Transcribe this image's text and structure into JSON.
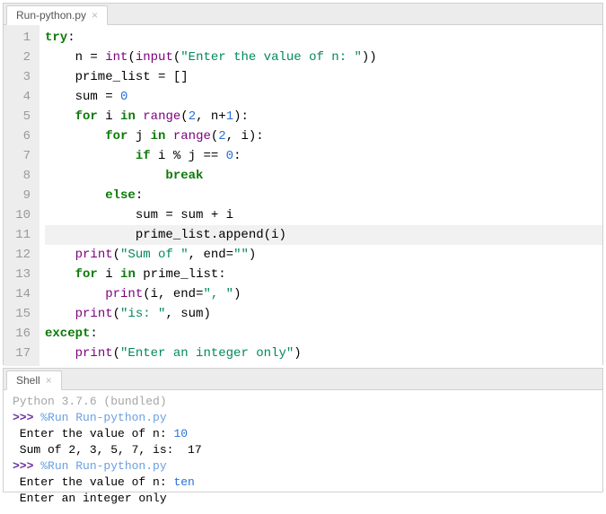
{
  "editor": {
    "tab_name": "Run-python.py",
    "gutter": [
      "1",
      "2",
      "3",
      "4",
      "5",
      "6",
      "7",
      "8",
      "9",
      "10",
      "11",
      "12",
      "13",
      "14",
      "15",
      "16",
      "17"
    ],
    "highlight_line_index": 10,
    "lines": [
      {
        "segs": [
          {
            "c": "kw",
            "t": "try"
          },
          {
            "t": ":"
          }
        ]
      },
      {
        "segs": [
          {
            "t": "    n = "
          },
          {
            "c": "bn",
            "t": "int"
          },
          {
            "t": "("
          },
          {
            "c": "bn",
            "t": "input"
          },
          {
            "t": "("
          },
          {
            "c": "str",
            "t": "\"Enter the value of n: \""
          },
          {
            "t": "))"
          }
        ]
      },
      {
        "segs": [
          {
            "t": "    prime_list = []"
          }
        ]
      },
      {
        "segs": [
          {
            "t": "    sum = "
          },
          {
            "c": "num",
            "t": "0"
          }
        ]
      },
      {
        "segs": [
          {
            "t": "    "
          },
          {
            "c": "kw",
            "t": "for"
          },
          {
            "t": " i "
          },
          {
            "c": "kw",
            "t": "in"
          },
          {
            "t": " "
          },
          {
            "c": "bn",
            "t": "range"
          },
          {
            "t": "("
          },
          {
            "c": "num",
            "t": "2"
          },
          {
            "t": ", n+"
          },
          {
            "c": "num",
            "t": "1"
          },
          {
            "t": "):"
          }
        ]
      },
      {
        "segs": [
          {
            "t": "        "
          },
          {
            "c": "kw",
            "t": "for"
          },
          {
            "t": " j "
          },
          {
            "c": "kw",
            "t": "in"
          },
          {
            "t": " "
          },
          {
            "c": "bn",
            "t": "range"
          },
          {
            "t": "("
          },
          {
            "c": "num",
            "t": "2"
          },
          {
            "t": ", i):"
          }
        ]
      },
      {
        "segs": [
          {
            "t": "            "
          },
          {
            "c": "kw",
            "t": "if"
          },
          {
            "t": " i % j == "
          },
          {
            "c": "num",
            "t": "0"
          },
          {
            "t": ":"
          }
        ]
      },
      {
        "segs": [
          {
            "t": "                "
          },
          {
            "c": "kw",
            "t": "break"
          }
        ]
      },
      {
        "segs": [
          {
            "t": "        "
          },
          {
            "c": "kw",
            "t": "else"
          },
          {
            "t": ":"
          }
        ]
      },
      {
        "segs": [
          {
            "t": "            sum = sum + i"
          }
        ]
      },
      {
        "segs": [
          {
            "t": "            prime_list.append(i)"
          }
        ]
      },
      {
        "segs": [
          {
            "t": "    "
          },
          {
            "c": "bn",
            "t": "print"
          },
          {
            "t": "("
          },
          {
            "c": "str",
            "t": "\"Sum of \""
          },
          {
            "t": ", end="
          },
          {
            "c": "str",
            "t": "\"\""
          },
          {
            "t": ")"
          }
        ]
      },
      {
        "segs": [
          {
            "t": "    "
          },
          {
            "c": "kw",
            "t": "for"
          },
          {
            "t": " i "
          },
          {
            "c": "kw",
            "t": "in"
          },
          {
            "t": " prime_list:"
          }
        ]
      },
      {
        "segs": [
          {
            "t": "        "
          },
          {
            "c": "bn",
            "t": "print"
          },
          {
            "t": "(i, end="
          },
          {
            "c": "str",
            "t": "\", \""
          },
          {
            "t": ")"
          }
        ]
      },
      {
        "segs": [
          {
            "t": "    "
          },
          {
            "c": "bn",
            "t": "print"
          },
          {
            "t": "("
          },
          {
            "c": "str",
            "t": "\"is: \""
          },
          {
            "t": ", sum)"
          }
        ]
      },
      {
        "segs": [
          {
            "c": "kw",
            "t": "except"
          },
          {
            "t": ":"
          }
        ]
      },
      {
        "segs": [
          {
            "t": "    "
          },
          {
            "c": "bn",
            "t": "print"
          },
          {
            "t": "("
          },
          {
            "c": "str",
            "t": "\"Enter an integer only\""
          },
          {
            "t": ")"
          }
        ]
      }
    ]
  },
  "shell": {
    "tab_name": "Shell",
    "lines": [
      {
        "segs": [
          {
            "c": "muted",
            "t": "Python 3.7.6 (bundled)"
          }
        ]
      },
      {
        "segs": [
          {
            "c": "prompt",
            "t": ">>> "
          },
          {
            "c": "runcmd",
            "t": "%Run Run-python.py"
          }
        ]
      },
      {
        "segs": [
          {
            "t": " Enter the value of n: "
          },
          {
            "c": "uinp",
            "t": "10"
          }
        ]
      },
      {
        "segs": [
          {
            "t": " Sum of 2, 3, 5, 7, is:  17"
          }
        ]
      },
      {
        "segs": [
          {
            "c": "prompt",
            "t": ">>> "
          },
          {
            "c": "runcmd",
            "t": "%Run Run-python.py"
          }
        ]
      },
      {
        "segs": [
          {
            "t": " Enter the value of n: "
          },
          {
            "c": "uinp",
            "t": "ten"
          }
        ]
      },
      {
        "segs": [
          {
            "t": " Enter an integer only"
          }
        ]
      }
    ]
  }
}
